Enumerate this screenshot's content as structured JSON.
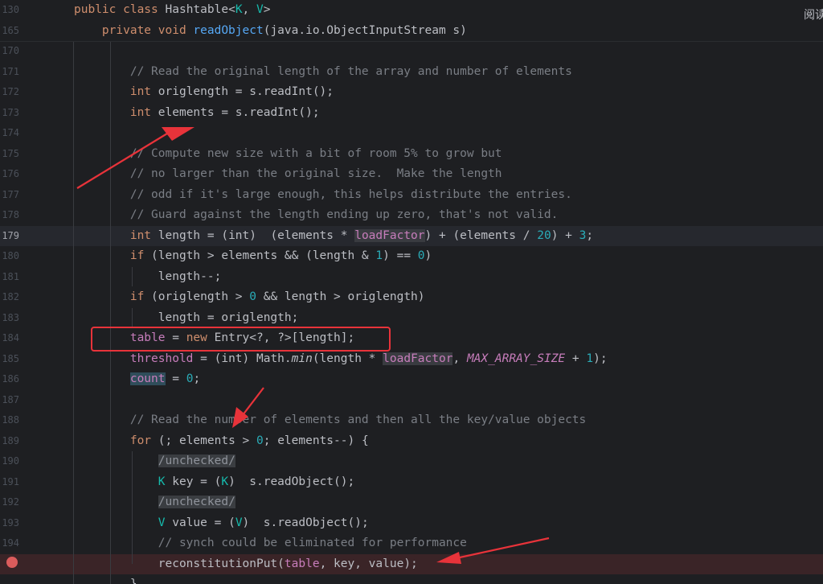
{
  "editor": {
    "reader_label": "阅读",
    "breakpoint_line": "195",
    "sticky_lines": [
      {
        "num": "130",
        "tokens": [
          {
            "t": "public class ",
            "c": "kw"
          },
          {
            "t": "Hashtable<"
          },
          {
            "t": "K",
            "c": "tp"
          },
          {
            "t": ", "
          },
          {
            "t": "V",
            "c": "tp"
          },
          {
            "t": ">"
          }
        ]
      },
      {
        "num": "165",
        "tokens": [
          {
            "t": "    private void ",
            "c": "kw"
          },
          {
            "t": "readObject",
            "c": "fn"
          },
          {
            "t": "(java.io.ObjectInputStream s)"
          }
        ]
      }
    ],
    "lines": [
      {
        "num": "170",
        "tokens": []
      },
      {
        "num": "171",
        "tokens": [
          {
            "t": "        // Read the original length of the array and number of elements",
            "c": "cm"
          }
        ]
      },
      {
        "num": "172",
        "tokens": [
          {
            "t": "        "
          },
          {
            "t": "int",
            "c": "kw"
          },
          {
            "t": " origlength = s.readInt();"
          }
        ]
      },
      {
        "num": "173",
        "tokens": [
          {
            "t": "        "
          },
          {
            "t": "int",
            "c": "kw"
          },
          {
            "t": " elements = s.readInt();"
          }
        ]
      },
      {
        "num": "174",
        "tokens": []
      },
      {
        "num": "175",
        "tokens": [
          {
            "t": "        // Compute new size with a bit of room 5% to grow but",
            "c": "cm"
          }
        ]
      },
      {
        "num": "176",
        "tokens": [
          {
            "t": "        // no larger than the original size.  Make the length",
            "c": "cm"
          }
        ]
      },
      {
        "num": "177",
        "tokens": [
          {
            "t": "        // odd if it's large enough, this helps distribute the entries.",
            "c": "cm"
          }
        ]
      },
      {
        "num": "178",
        "tokens": [
          {
            "t": "        // Guard against the length ending up zero, that's not valid.",
            "c": "cm"
          }
        ]
      },
      {
        "num": "179",
        "current": true,
        "tokens": [
          {
            "t": "        "
          },
          {
            "t": "int",
            "c": "kw"
          },
          {
            "t": " length = (int)  (elements * "
          },
          {
            "t": "loadFactor",
            "c": "fld hl"
          },
          {
            "t": ") + (elements / "
          },
          {
            "t": "20",
            "c": "num"
          },
          {
            "t": ") + "
          },
          {
            "t": "3",
            "c": "num"
          },
          {
            "t": ";"
          }
        ]
      },
      {
        "num": "180",
        "tokens": [
          {
            "t": "        "
          },
          {
            "t": "if",
            "c": "kw"
          },
          {
            "t": " (length > elements && (length & "
          },
          {
            "t": "1",
            "c": "num"
          },
          {
            "t": ") == "
          },
          {
            "t": "0",
            "c": "num"
          },
          {
            "t": ")"
          }
        ]
      },
      {
        "num": "181",
        "tokens": [
          {
            "t": "            length--;"
          }
        ]
      },
      {
        "num": "182",
        "tokens": [
          {
            "t": "        "
          },
          {
            "t": "if",
            "c": "kw"
          },
          {
            "t": " (origlength > "
          },
          {
            "t": "0",
            "c": "num"
          },
          {
            "t": " && length > origlength)"
          }
        ]
      },
      {
        "num": "183",
        "tokens": [
          {
            "t": "            length = origlength;"
          }
        ]
      },
      {
        "num": "184",
        "tokens": [
          {
            "t": "        "
          },
          {
            "t": "table",
            "c": "fld"
          },
          {
            "t": " = "
          },
          {
            "t": "new",
            "c": "kw"
          },
          {
            "t": " Entry<?, ?>[length];"
          }
        ]
      },
      {
        "num": "185",
        "tokens": [
          {
            "t": "        "
          },
          {
            "t": "threshold",
            "c": "fld"
          },
          {
            "t": " = (int) Math."
          },
          {
            "t": "min",
            "c": "st"
          },
          {
            "t": "(length * "
          },
          {
            "t": "loadFactor",
            "c": "fld hl"
          },
          {
            "t": ", "
          },
          {
            "t": "MAX_ARRAY_SIZE",
            "c": "cst"
          },
          {
            "t": " + "
          },
          {
            "t": "1",
            "c": "num"
          },
          {
            "t": ");"
          }
        ]
      },
      {
        "num": "186",
        "tokens": [
          {
            "t": "        "
          },
          {
            "t": "count",
            "c": "fld hlcount"
          },
          {
            "t": " = "
          },
          {
            "t": "0",
            "c": "num"
          },
          {
            "t": ";"
          }
        ]
      },
      {
        "num": "187",
        "tokens": []
      },
      {
        "num": "188",
        "tokens": [
          {
            "t": "        // Read the number of elements and then all the key/value objects",
            "c": "cm"
          }
        ]
      },
      {
        "num": "189",
        "tokens": [
          {
            "t": "        "
          },
          {
            "t": "for",
            "c": "kw"
          },
          {
            "t": " (; elements > "
          },
          {
            "t": "0",
            "c": "num"
          },
          {
            "t": "; elements--) {"
          }
        ]
      },
      {
        "num": "190",
        "tokens": [
          {
            "t": "            "
          },
          {
            "t": "/unchecked/",
            "c": "sup"
          }
        ]
      },
      {
        "num": "191",
        "tokens": [
          {
            "t": "            "
          },
          {
            "t": "K",
            "c": "tp"
          },
          {
            "t": " key = ("
          },
          {
            "t": "K",
            "c": "tp"
          },
          {
            "t": ")  s.readObject();"
          }
        ]
      },
      {
        "num": "192",
        "tokens": [
          {
            "t": "            "
          },
          {
            "t": "/unchecked/",
            "c": "sup"
          }
        ]
      },
      {
        "num": "193",
        "tokens": [
          {
            "t": "            "
          },
          {
            "t": "V",
            "c": "tp"
          },
          {
            "t": " value = ("
          },
          {
            "t": "V",
            "c": "tp"
          },
          {
            "t": ")  s.readObject();"
          }
        ]
      },
      {
        "num": "194",
        "tokens": [
          {
            "t": "            // synch could be eliminated for performance",
            "c": "cm"
          }
        ]
      },
      {
        "num": "",
        "bp": true,
        "tokens": [
          {
            "t": "            reconstitutionPut("
          },
          {
            "t": "table",
            "c": "fld"
          },
          {
            "t": ", key, value);"
          }
        ]
      },
      {
        "num": "",
        "tokens": [
          {
            "t": "        }"
          }
        ]
      }
    ]
  }
}
